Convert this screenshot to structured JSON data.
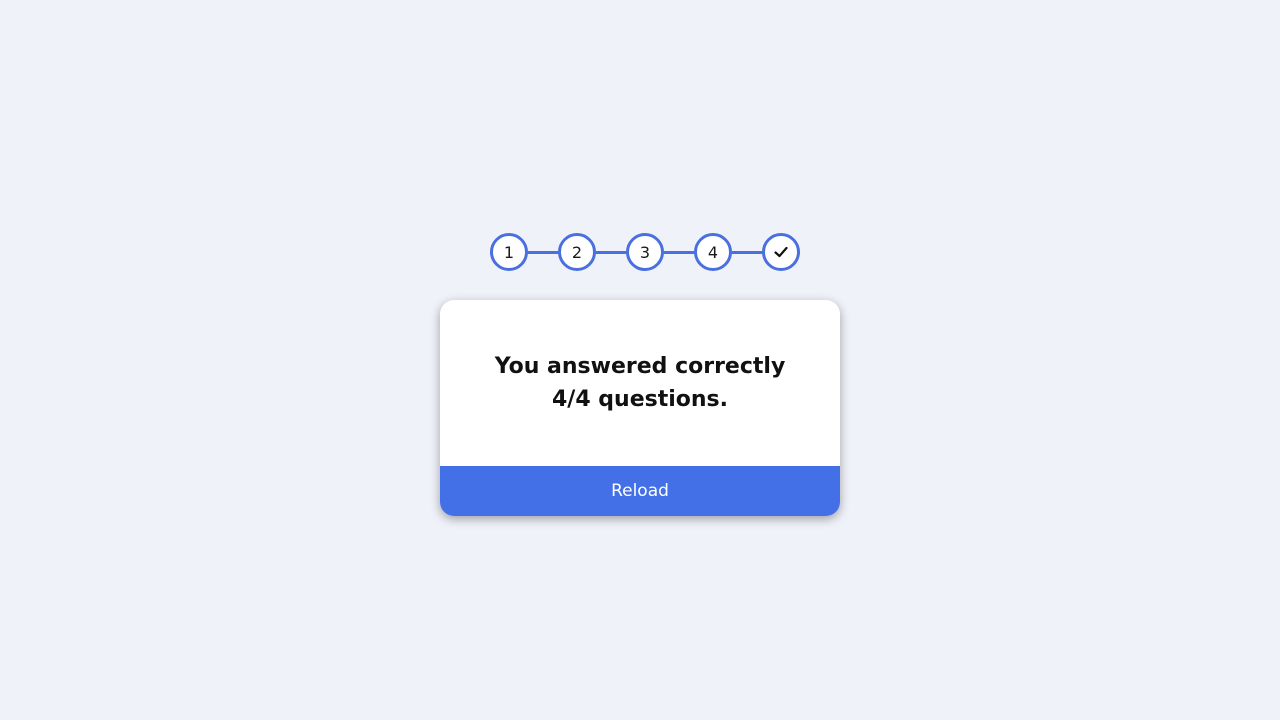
{
  "stepper": {
    "steps": [
      "1",
      "2",
      "3",
      "4"
    ],
    "final_icon": "check-icon",
    "accent_color": "#4a6fde"
  },
  "result": {
    "message": "You answered correctly 4/4 questions."
  },
  "reload_button": {
    "label": "Reload",
    "color": "#4370e6"
  },
  "page": {
    "background_color": "#f0f2fa"
  }
}
